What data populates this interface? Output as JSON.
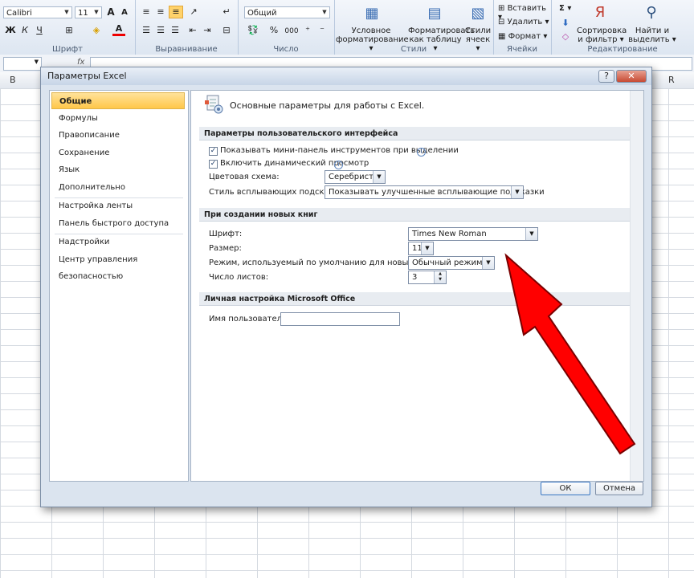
{
  "ribbon": {
    "font_name": "Calibri",
    "font_size": "11",
    "number_format": "Общий",
    "groups": {
      "font": "Шрифт",
      "alignment": "Выравнивание",
      "number": "Число",
      "styles": "Стили",
      "cells": "Ячейки",
      "editing": "Редактирование"
    },
    "bold": "Ж",
    "italic": "К",
    "underline": "Ч",
    "percent": "%",
    "thousands": "000",
    "conditional_formatting": [
      "Условное",
      "форматирование ▾"
    ],
    "format_as_table": [
      "Форматировать",
      "как таблицу ▾"
    ],
    "cell_styles": [
      "Стили",
      "ячеек ▾"
    ],
    "insert": "Вставить ▾",
    "delete": "Удалить ▾",
    "format": "Формат ▾",
    "sigma": "Σ ▾",
    "sort_filter": [
      "Сортировка",
      "и фильтр ▾"
    ],
    "find_select": [
      "Найти и",
      "выделить ▾"
    ],
    "fx": "fx"
  },
  "sheet": {
    "col_b": "B",
    "col_r": "R"
  },
  "dialog": {
    "title": "Параметры Excel",
    "help": "?",
    "close": "✕",
    "nav": [
      "Общие",
      "Формулы",
      "Правописание",
      "Сохранение",
      "Язык",
      "Дополнительно",
      "Настройка ленты",
      "Панель быстрого доступа",
      "Надстройки",
      "Центр управления безопасностью"
    ],
    "header": "Основные параметры для работы с Excel.",
    "section_ui": "Параметры пользовательского интерфейса",
    "show_minitoolbar": "Показывать мини-панель инструментов при выделении",
    "live_preview": "Включить динамический просмотр",
    "color_scheme_label": "Цветовая схема:",
    "color_scheme_value": "Серебристая",
    "tooltip_style_label": "Стиль всплывающих подсказок:",
    "tooltip_style_value": "Показывать улучшенные всплывающие подсказки",
    "section_new": "При создании новых книг",
    "font_label": "Шрифт:",
    "font_value": "Times New Roman",
    "size_label": "Размер:",
    "size_value": "11",
    "view_label": "Режим, используемый по умолчанию для новых листов:",
    "view_value": "Обычный режим",
    "sheets_label": "Число листов:",
    "sheets_value": "3",
    "section_personal": "Личная настройка Microsoft Office",
    "username_label": "Имя пользователя:",
    "username_value": "",
    "ok": "ОК",
    "cancel": "Отмена"
  },
  "colors": {
    "selected_nav": "#ffc74a",
    "arrow": "#ff0000"
  }
}
